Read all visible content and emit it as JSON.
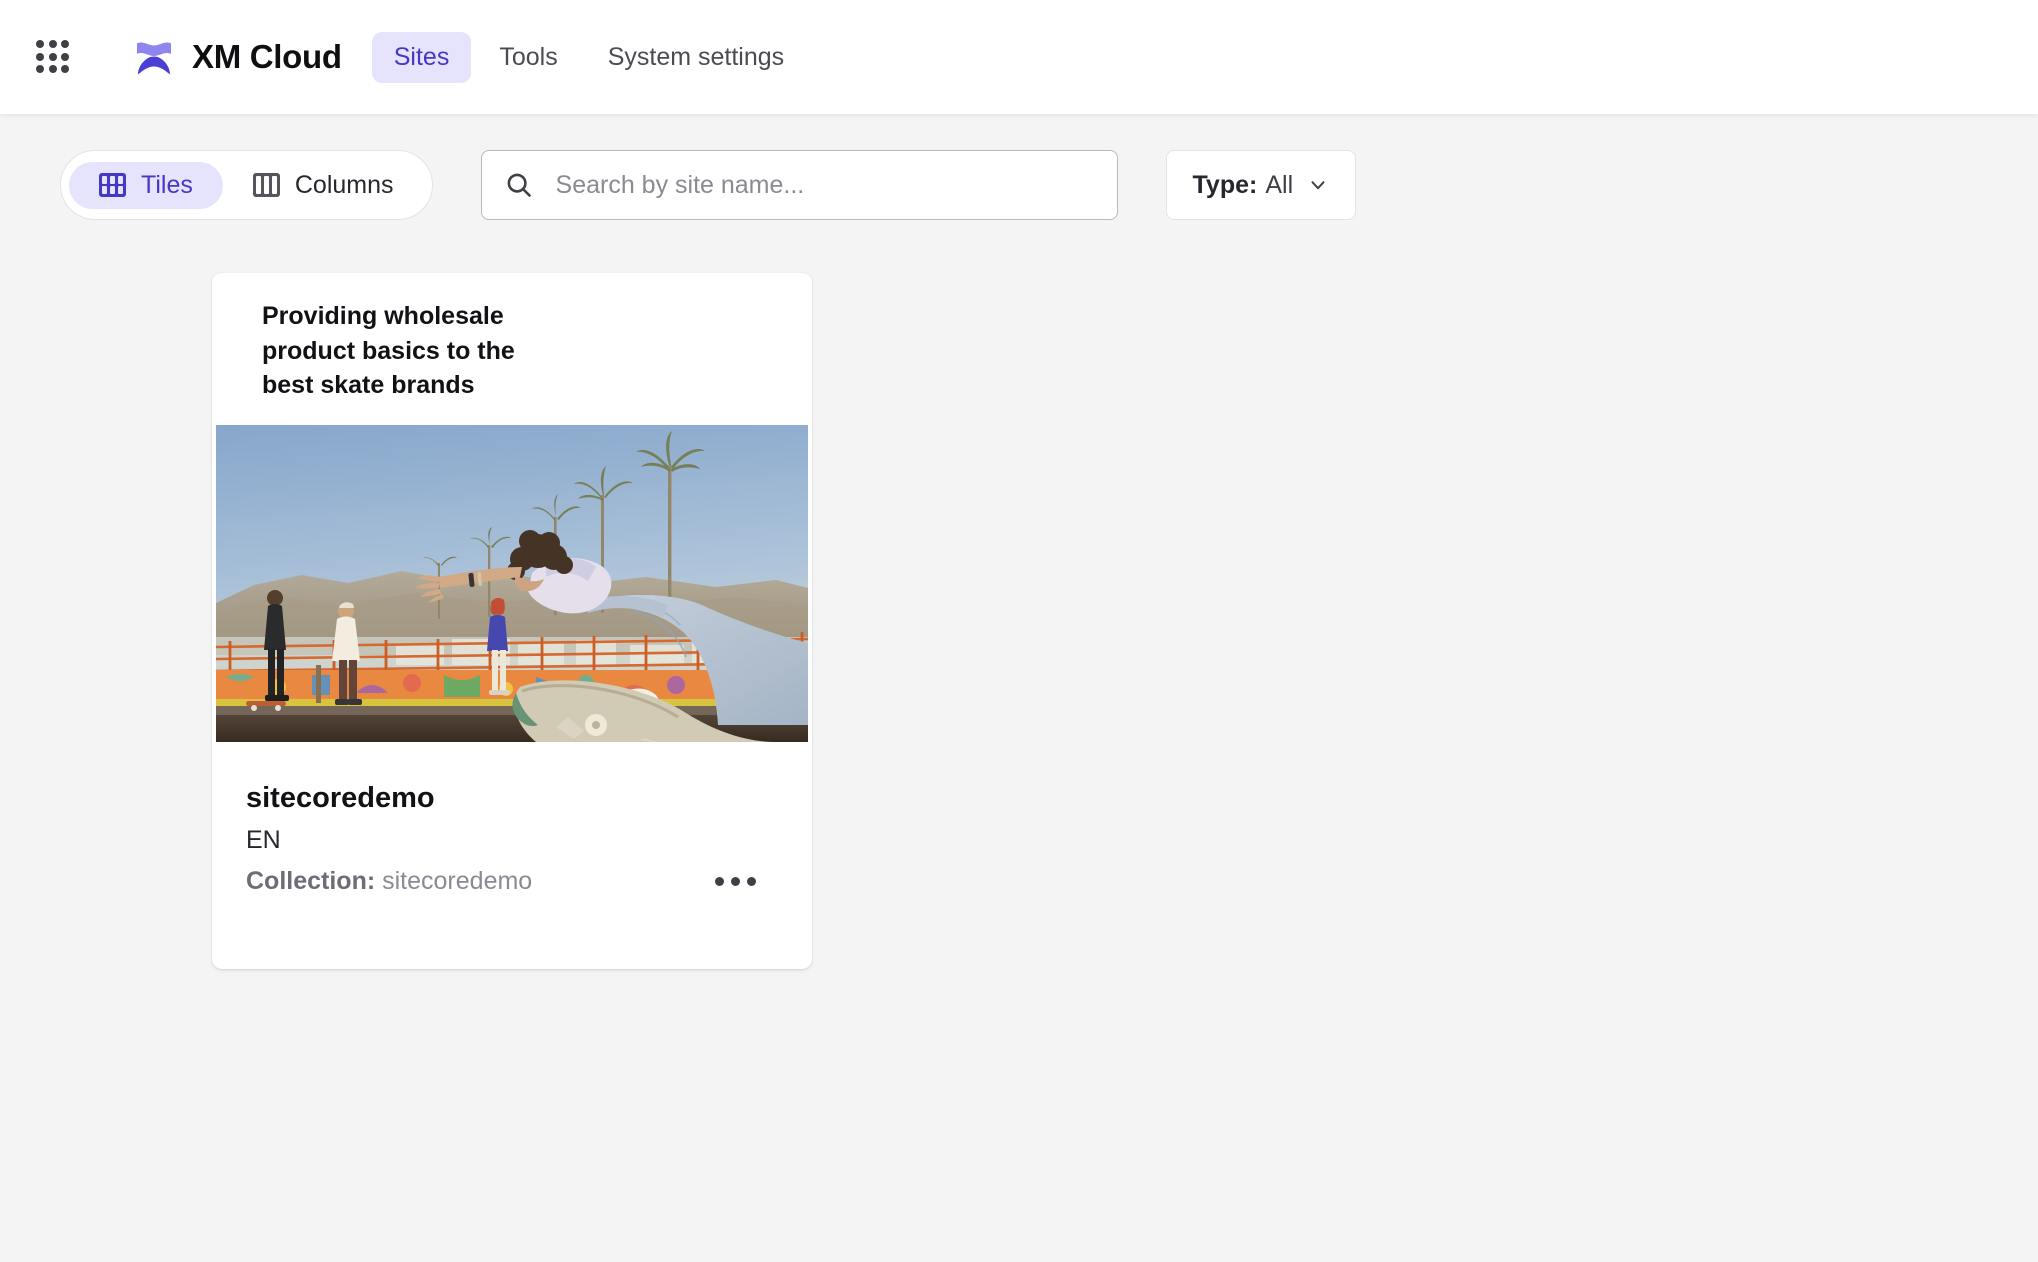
{
  "header": {
    "apps_grid_icon": "apps-grid-icon",
    "brand_logo_icon": "sitecore-logo-icon",
    "brand_name": "XM Cloud",
    "nav": [
      {
        "label": "Sites",
        "active": true
      },
      {
        "label": "Tools",
        "active": false
      },
      {
        "label": "System settings",
        "active": false
      }
    ]
  },
  "toolbar": {
    "view_toggle": [
      {
        "label": "Tiles",
        "icon": "tiles-icon",
        "active": true
      },
      {
        "label": "Columns",
        "icon": "columns-icon",
        "active": false
      }
    ],
    "search": {
      "icon": "search-icon",
      "placeholder": "Search by site name...",
      "value": ""
    },
    "type_filter": {
      "label": "Type:",
      "value": "All",
      "chevron_icon": "chevron-down-icon"
    }
  },
  "sites": [
    {
      "headline": "Providing wholesale product basics to the best skate brands",
      "thumbnail_alt": "skatepark-photo",
      "name": "sitecoredemo",
      "language": "EN",
      "collection_label": "Collection:",
      "collection_value": "sitecoredemo",
      "menu_icon": "more-options-icon"
    }
  ],
  "colors": {
    "accent": "#4339c4",
    "accent_soft": "#e6e3fd",
    "page_bg": "#f4f4f5",
    "surface": "#ffffff",
    "text_primary": "#121216",
    "text_muted": "#8a8a93"
  }
}
